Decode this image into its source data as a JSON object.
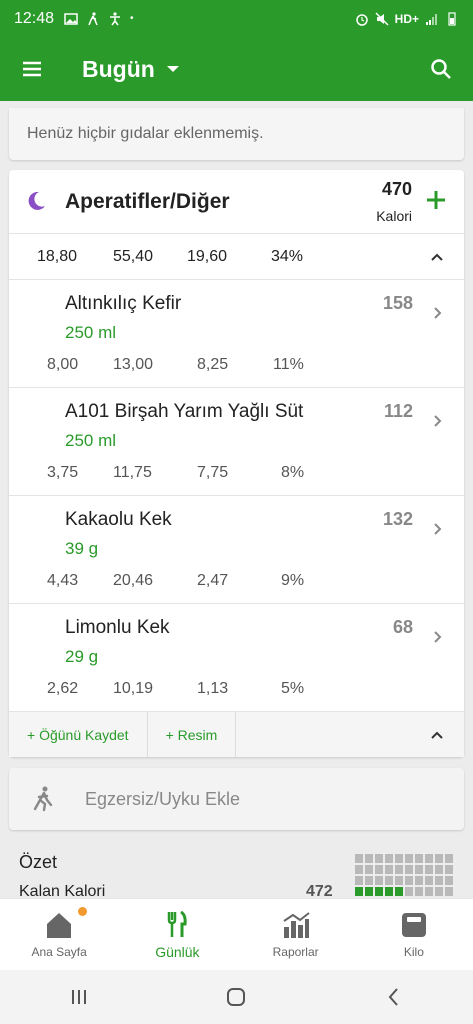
{
  "status": {
    "time": "12:48",
    "network": "HD+"
  },
  "appbar": {
    "title": "Bugün"
  },
  "empty_message": "Henüz hiçbir gıdalar eklenmemiş.",
  "meal": {
    "title": "Aperatifler/Diğer",
    "calories": "470",
    "calories_unit": "Kalori",
    "totals": [
      "18,80",
      "55,40",
      "19,60",
      "34%"
    ],
    "foods": [
      {
        "name": "Altınkılıç Kefir",
        "amount": "250 ml",
        "calories": "158",
        "nutrients": [
          "8,00",
          "13,00",
          "8,25",
          "11%"
        ]
      },
      {
        "name": "A101 Birşah Yarım Yağlı Süt",
        "amount": "250  ml",
        "calories": "112",
        "nutrients": [
          "3,75",
          "11,75",
          "7,75",
          "8%"
        ]
      },
      {
        "name": "Kakaolu Kek",
        "amount": "39  g",
        "calories": "132",
        "nutrients": [
          "4,43",
          "20,46",
          "2,47",
          "9%"
        ]
      },
      {
        "name": "Limonlu Kek",
        "amount": "29  g",
        "calories": "68",
        "nutrients": [
          "2,62",
          "10,19",
          "1,13",
          "5%"
        ]
      }
    ],
    "footer": {
      "save_meal": "+ Öğünü Kaydet",
      "picture": "+ Resim"
    }
  },
  "exercise": {
    "label": "Egzersiz/Uyku Ekle"
  },
  "summary": {
    "title": "Özet",
    "remaining_label": "Kalan Kalori",
    "remaining_value": "472"
  },
  "bottom_nav": [
    "Ana Sayfa",
    "Günlük",
    "Raporlar",
    "Kilo"
  ],
  "colors": {
    "primary": "#2a9b2a",
    "accent_orange": "#f29a2e",
    "moon": "#8a4fc4"
  }
}
